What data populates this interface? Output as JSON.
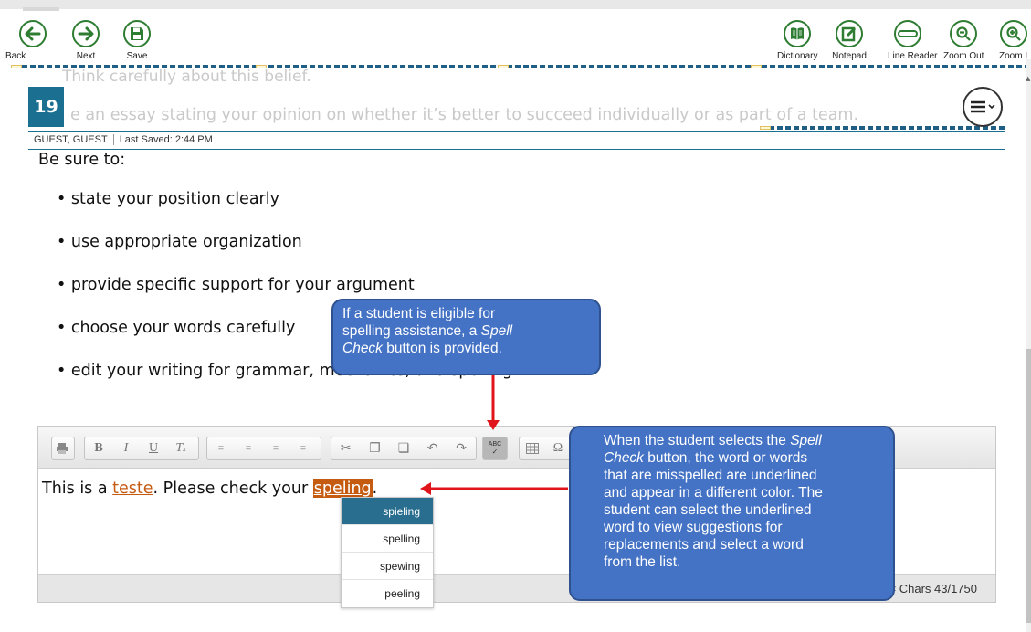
{
  "toolbar": {
    "back_label": "Back",
    "next_label": "Next",
    "save_label": "Save",
    "dictionary_label": "Dictionary",
    "notepad_label": "Notepad",
    "line_reader_label": "Line Reader",
    "zoom_out_label": "Zoom Out",
    "zoom_in_label": "Zoom I"
  },
  "question": {
    "number": "19",
    "ghost_line1": "Think carefully about this belief.",
    "ghost_line2": "e an essay stating your opinion on whether it’s better to succeed individually or as part of a team.",
    "user": "GUEST, GUEST",
    "last_saved": "Last Saved: 2:44 PM"
  },
  "prompt": {
    "intro": "Be sure to:",
    "bullets": [
      "• state your position clearly",
      "• use appropriate organization",
      "• provide specific support for your argument",
      "• choose your words carefully",
      "• edit your writing for grammar, mechanics, and spelling"
    ]
  },
  "editor": {
    "text_before": "This is a ",
    "word1": "teste",
    "text_middle": ". Please check your ",
    "word2": "speling",
    "text_after": ".",
    "char_count": "# Chars 43/1750",
    "spellcheck_label": "ABC"
  },
  "suggestions": [
    "spieling",
    "spelling",
    "spewing",
    "peeling"
  ],
  "callouts": {
    "c1_line1": "If a student is eligible for",
    "c1_line2a": "spelling assistance, a ",
    "c1_line2b": "Spell",
    "c1_line3a": "Check",
    "c1_line3b": " button is provided.",
    "c2_line1a": "When the student selects the ",
    "c2_line1b": "Spell",
    "c2_line2a": "Check",
    "c2_line2b": " button, the word or words",
    "c2_line3": "that are misspelled are underlined",
    "c2_line4": "and appear in a different color. The",
    "c2_line5": "student can select the underlined",
    "c2_line6": "word to view suggestions for",
    "c2_line7": "replacements and select a word",
    "c2_line8": "from the list."
  },
  "colors": {
    "accent": "#1b6f91",
    "toolbar_green": "#2e7d32",
    "misspelled": "#c55a11",
    "callout": "#4472c4",
    "arrow": "#e0151b"
  }
}
